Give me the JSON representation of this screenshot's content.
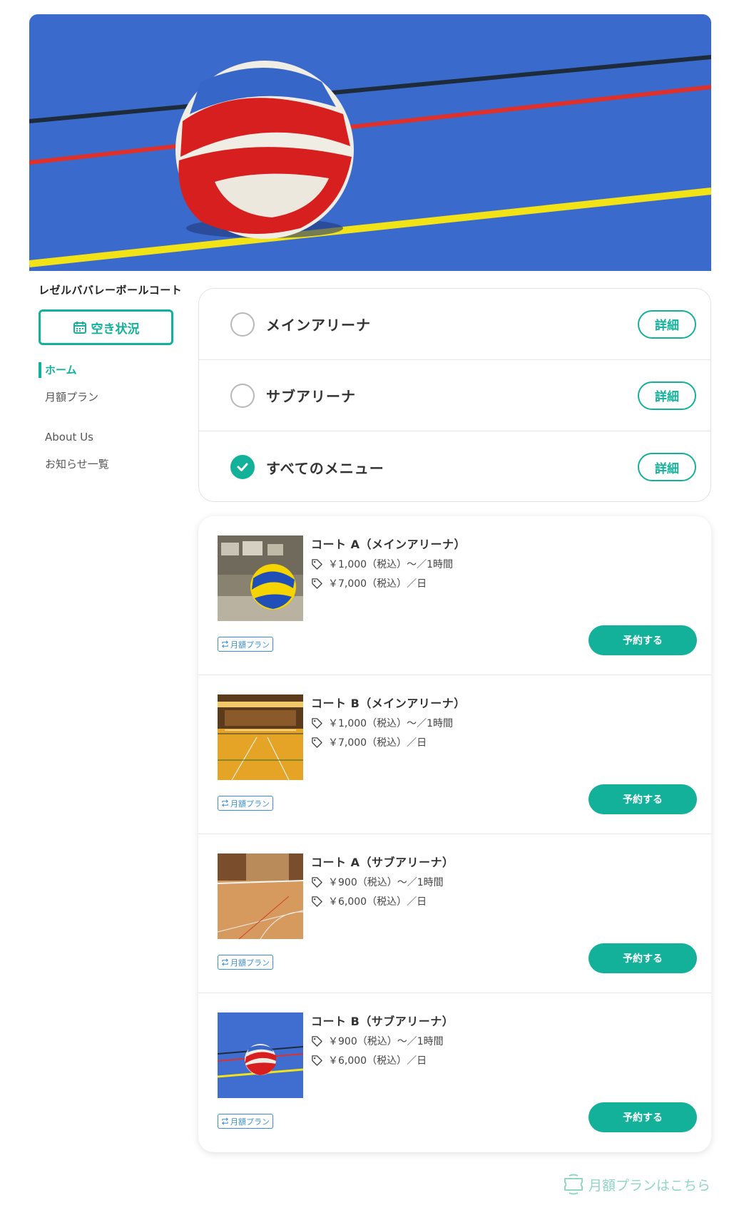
{
  "facility": {
    "name": "レゼルババレーボールコート"
  },
  "availability_button": {
    "label": "空き状況"
  },
  "nav": {
    "items": [
      {
        "label": "ホーム",
        "active": true
      },
      {
        "label": "月額プラン",
        "active": false
      },
      {
        "label": "About Us",
        "active": false
      },
      {
        "label": "お知らせ一覧",
        "active": false
      }
    ]
  },
  "categories": [
    {
      "label": "メインアリーナ",
      "checked": false,
      "detail_label": "詳細"
    },
    {
      "label": "サブアリーナ",
      "checked": false,
      "detail_label": "詳細"
    },
    {
      "label": "すべてのメニュー",
      "checked": true,
      "detail_label": "詳細"
    }
  ],
  "courts": [
    {
      "title": "コート A（メインアリーナ）",
      "price_hour": "￥1,000（税込）〜／1時間",
      "price_day": "￥7,000（税込）／日",
      "plan_badge": "月額プラン",
      "reserve_label": "予約する",
      "thumb": "yellow-blue-ball"
    },
    {
      "title": "コート B（メインアリーナ）",
      "price_hour": "￥1,000（税込）〜／1時間",
      "price_day": "￥7,000（税込）／日",
      "plan_badge": "月額プラン",
      "reserve_label": "予約する",
      "thumb": "orange-gym"
    },
    {
      "title": "コート A（サブアリーナ）",
      "price_hour": "￥900（税込）〜／1時間",
      "price_day": "￥6,000（税込）／日",
      "plan_badge": "月額プラン",
      "reserve_label": "予約する",
      "thumb": "wood-court"
    },
    {
      "title": "コート B（サブアリーナ）",
      "price_hour": "￥900（税込）〜／1時間",
      "price_day": "￥6,000（税込）／日",
      "plan_badge": "月額プラン",
      "reserve_label": "予約する",
      "thumb": "blue-court-ball"
    }
  ],
  "monthly_link": {
    "label": "月額プランはこちら"
  },
  "colors": {
    "accent": "#14b19a",
    "plan_blue": "#3a8fd6",
    "court_blue": "#3d6fd1"
  }
}
